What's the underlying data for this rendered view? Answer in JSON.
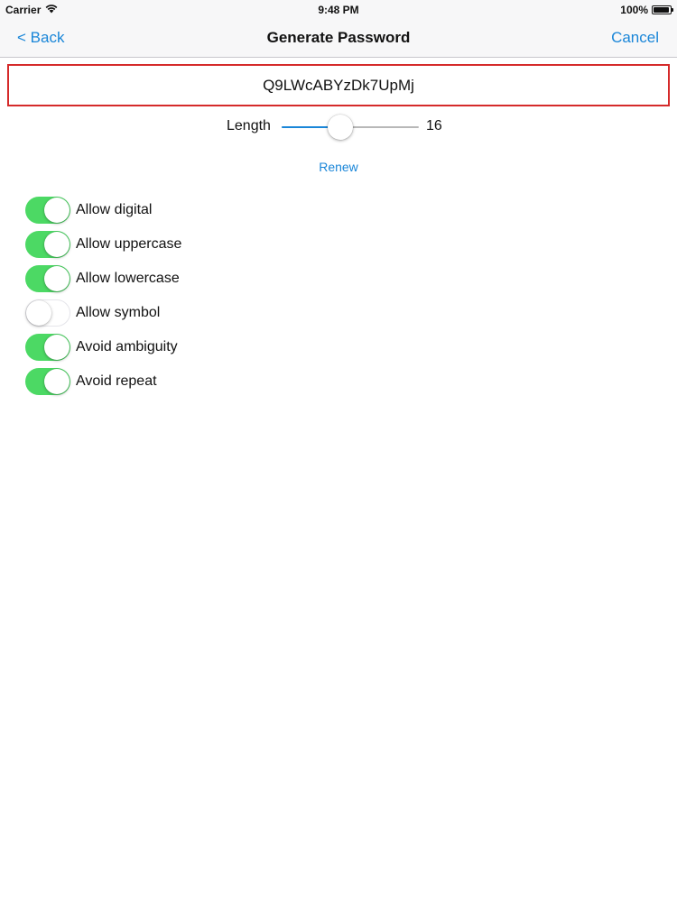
{
  "status_bar": {
    "carrier": "Carrier",
    "time": "9:48 PM",
    "battery": "100%",
    "battery_level": 1.0,
    "icons": [
      "wifi-icon",
      "battery-icon"
    ]
  },
  "nav": {
    "back_label": "< Back",
    "title": "Generate Password",
    "cancel_label": "Cancel"
  },
  "password": {
    "value": "Q9LWcABYzDk7UpMj"
  },
  "length": {
    "label": "Length",
    "value": "16",
    "slider_fraction": 0.43
  },
  "renew_label": "Renew",
  "options": [
    {
      "label": "Allow digital",
      "on": true
    },
    {
      "label": "Allow uppercase",
      "on": true
    },
    {
      "label": "Allow lowercase",
      "on": true
    },
    {
      "label": "Allow symbol",
      "on": false
    },
    {
      "label": "Avoid ambiguity",
      "on": true
    },
    {
      "label": "Avoid repeat",
      "on": true
    }
  ],
  "colors": {
    "accent": "#1a86d8",
    "switch_on": "#4cd964",
    "field_border": "#d52a2a"
  }
}
